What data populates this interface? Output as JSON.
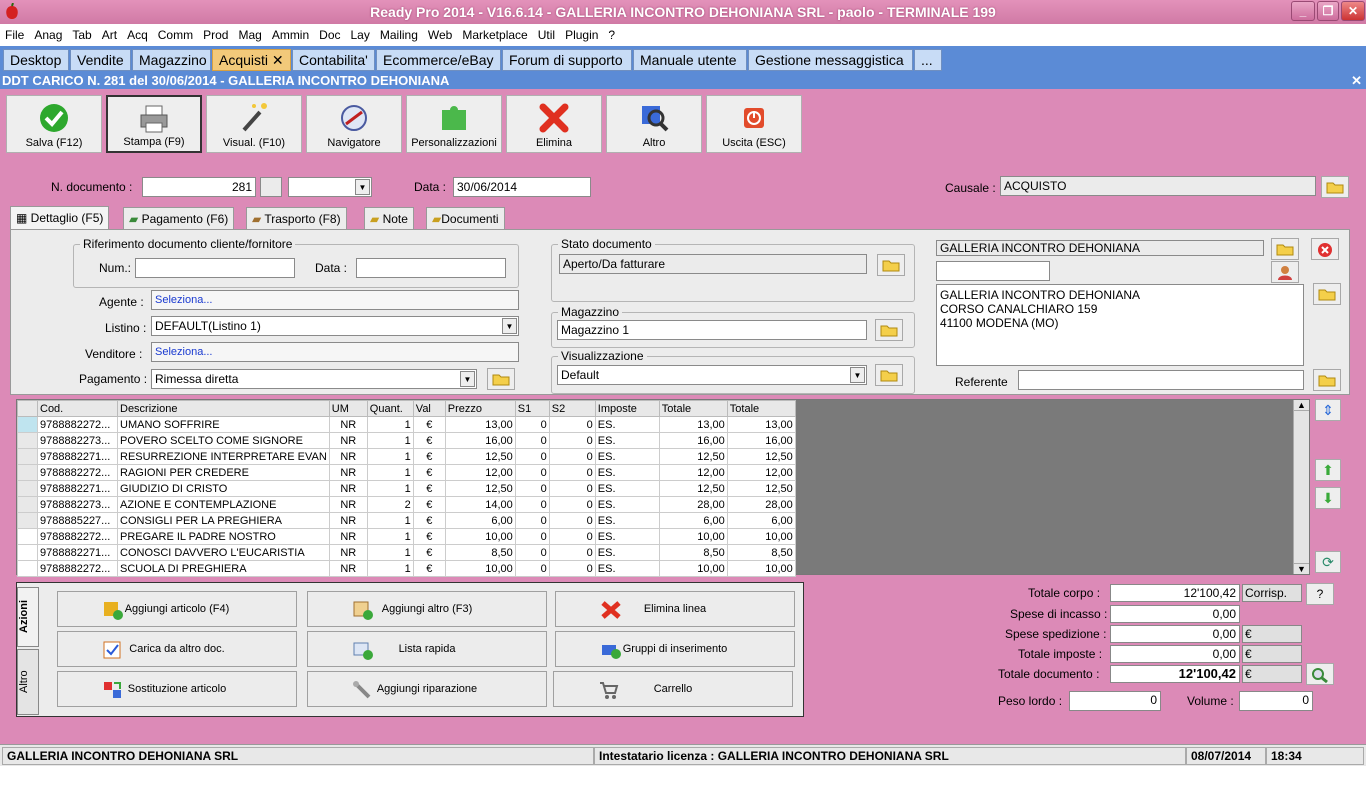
{
  "window": {
    "title": "Ready Pro 2014 - V16.6.14 - GALLERIA INCONTRO DEHONIANA SRL - paolo - TERMINALE 199"
  },
  "menu": [
    "File",
    "Anag",
    "Tab",
    "Art",
    "Acq",
    "Comm",
    "Prod",
    "Mag",
    "Ammin",
    "Doc",
    "Lay",
    "Mailing",
    "Web",
    "Marketplace",
    "Util",
    "Plugin",
    "?"
  ],
  "tabs": [
    "Desktop",
    "Vendite",
    "Magazzino",
    "Acquisti",
    "Contabilita'",
    "Ecommerce/eBay",
    "Forum di supporto",
    "Manuale utente",
    "Gestione messaggistica",
    "..."
  ],
  "doc_title": "DDT CARICO N. 281 del 30/06/2014 - GALLERIA INCONTRO DEHONIANA",
  "toolbar": {
    "save": "Salva (F12)",
    "print": "Stampa (F9)",
    "view": "Visual. (F10)",
    "nav": "Navigatore",
    "custom": "Personalizzazioni",
    "delete": "Elimina",
    "other": "Altro",
    "exit": "Uscita (ESC)"
  },
  "header": {
    "ndoc_label": "N. documento :",
    "ndoc": "281",
    "data_label": "Data :",
    "data": "30/06/2014",
    "causale_label": "Causale :",
    "causale": "ACQUISTO"
  },
  "page_tabs": [
    "Dettaglio (F5)",
    "Pagamento (F6)",
    "Trasporto (F8)",
    "Note",
    "Documenti"
  ],
  "detail": {
    "rif_title": "Riferimento documento cliente/fornitore",
    "num_label": "Num.:",
    "data_label": "Data :",
    "agente_label": "Agente :",
    "agente": "Seleziona...",
    "listino_label": "Listino :",
    "listino": "DEFAULT(Listino 1)",
    "venditore_label": "Venditore :",
    "venditore": "Seleziona...",
    "pagamento_label": "Pagamento :",
    "pagamento": "Rimessa diretta",
    "stato_title": "Stato documento",
    "stato": "Aperto/Da fatturare",
    "magazzino_title": "Magazzino",
    "magazzino": "Magazzino 1",
    "visual_title": "Visualizzazione",
    "visual": "Default",
    "fornitore": "GALLERIA INCONTRO DEHONIANA",
    "addr1": "GALLERIA INCONTRO DEHONIANA",
    "addr2": "CORSO CANALCHIARO 159",
    "addr3": "41100 MODENA (MO)",
    "referente_label": "Referente"
  },
  "grid": {
    "headers": [
      "Cod.",
      "Descrizione",
      "UM",
      "Quant.",
      "Val",
      "Prezzo",
      "S1",
      "S2",
      "Imposte",
      "Totale",
      "Totale"
    ],
    "rows": [
      [
        "9788882272...",
        "UMANO SOFFRIRE",
        "NR",
        "1",
        "€",
        "13,00",
        "0",
        "0",
        "ES.",
        "13,00",
        "13,00"
      ],
      [
        "9788882273...",
        "POVERO SCELTO COME SIGNORE",
        "NR",
        "1",
        "€",
        "16,00",
        "0",
        "0",
        "ES.",
        "16,00",
        "16,00"
      ],
      [
        "9788882271...",
        "RESURREZIONE INTERPRETARE EVAN",
        "NR",
        "1",
        "€",
        "12,50",
        "0",
        "0",
        "ES.",
        "12,50",
        "12,50"
      ],
      [
        "9788882272...",
        "RAGIONI PER  CREDERE",
        "NR",
        "1",
        "€",
        "12,00",
        "0",
        "0",
        "ES.",
        "12,00",
        "12,00"
      ],
      [
        "9788882271...",
        "GIUDIZIO DI CRISTO",
        "NR",
        "1",
        "€",
        "12,50",
        "0",
        "0",
        "ES.",
        "12,50",
        "12,50"
      ],
      [
        "9788882273...",
        "AZIONE E CONTEMPLAZIONE",
        "NR",
        "2",
        "€",
        "14,00",
        "0",
        "0",
        "ES.",
        "28,00",
        "28,00"
      ],
      [
        "9788885227...",
        "CONSIGLI PER LA PREGHIERA",
        "NR",
        "1",
        "€",
        "6,00",
        "0",
        "0",
        "ES.",
        "6,00",
        "6,00"
      ],
      [
        "9788882272...",
        "PREGARE IL PADRE NOSTRO",
        "NR",
        "1",
        "€",
        "10,00",
        "0",
        "0",
        "ES.",
        "10,00",
        "10,00"
      ],
      [
        "9788882271...",
        "CONOSCI DAVVERO L'EUCARISTIA",
        "NR",
        "1",
        "€",
        "8,50",
        "0",
        "0",
        "ES.",
        "8,50",
        "8,50"
      ],
      [
        "9788882272...",
        "SCUOLA DI PREGHIERA",
        "NR",
        "1",
        "€",
        "10,00",
        "0",
        "0",
        "ES.",
        "10,00",
        "10,00"
      ]
    ]
  },
  "actions": {
    "tab_azioni": "Azioni",
    "tab_altro": "Altro",
    "add_article": "Aggiungi articolo (F4)",
    "add_other": "Aggiungi altro (F3)",
    "delete_line": "Elimina linea",
    "load_doc": "Carica da altro doc.",
    "quick_list": "Lista rapida",
    "insert_groups": "Gruppi di inserimento",
    "replace": "Sostituzione articolo",
    "add_repair": "Aggiungi riparazione",
    "cart": "Carrello"
  },
  "totals": {
    "corpo_label": "Totale corpo :",
    "corpo": "12'100,42",
    "corrisp": "Corrisp.",
    "q": "?",
    "incasso_label": "Spese di incasso :",
    "incasso": "0,00",
    "spedizione_label": "Spese spedizione :",
    "spedizione": "0,00",
    "euro": "€",
    "imposte_label": "Totale imposte :",
    "imposte": "0,00",
    "documento_label": "Totale documento :",
    "documento": "12'100,42",
    "peso_label": "Peso lordo :",
    "peso": "0",
    "volume_label": "Volume :",
    "volume": "0"
  },
  "status": {
    "company": "GALLERIA INCONTRO DEHONIANA SRL",
    "license": "Intestatario licenza : GALLERIA INCONTRO DEHONIANA SRL",
    "date": "08/07/2014",
    "time": "18:34"
  }
}
